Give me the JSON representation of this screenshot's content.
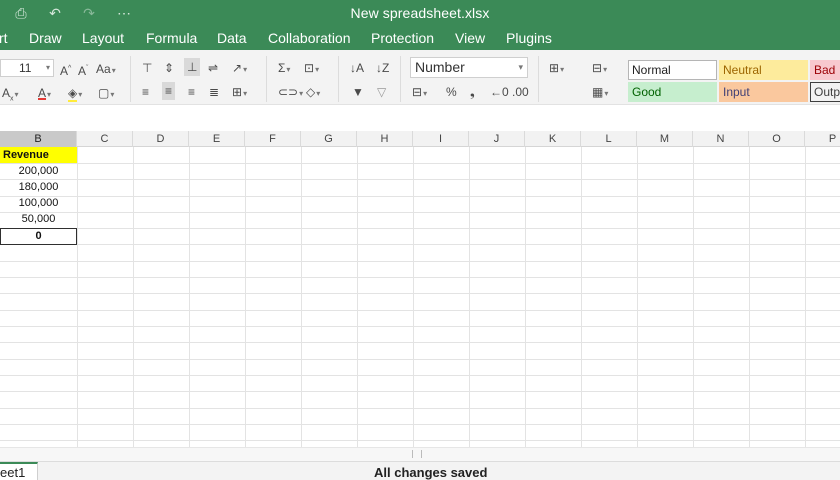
{
  "window": {
    "title": "New spreadsheet.xlsx"
  },
  "menu": [
    "rt",
    "Draw",
    "Layout",
    "Formula",
    "Data",
    "Collaboration",
    "Protection",
    "View",
    "Plugins"
  ],
  "toolbar": {
    "font_size": "11",
    "number_format": "Number",
    "styles": [
      {
        "label": "Normal",
        "bg": "#ffffff",
        "border": "#b5b5b5",
        "color": "#222222"
      },
      {
        "label": "Neutral",
        "bg": "#fdeb9c",
        "border": "#fdeb9c",
        "color": "#9c6500"
      },
      {
        "label": "Bad",
        "bg": "#f8c8ce",
        "border": "#f8c8ce",
        "color": "#9c0006"
      },
      {
        "label": "Good",
        "bg": "#c6eece",
        "border": "#c6eece",
        "color": "#006100"
      },
      {
        "label": "Input",
        "bg": "#fac89e",
        "border": "#fac89e",
        "color": "#3f3f76"
      },
      {
        "label": "Outp",
        "bg": "#f2f2f2",
        "border": "#3f3f3f",
        "color": "#3f3f3f"
      }
    ]
  },
  "grid": {
    "columns": [
      "B",
      "C",
      "D",
      "E",
      "F",
      "G",
      "H",
      "I",
      "J",
      "K",
      "L",
      "M",
      "N",
      "O",
      "P"
    ],
    "header_cell": "Revenue",
    "values": [
      "200,000",
      "180,000",
      "100,000",
      "50,000"
    ],
    "active_value": "0"
  },
  "status": {
    "sheet_tab": "eet1",
    "message": "All changes saved"
  },
  "colors": {
    "accent": "#3b8a57",
    "header_fill": "#ffff00"
  }
}
